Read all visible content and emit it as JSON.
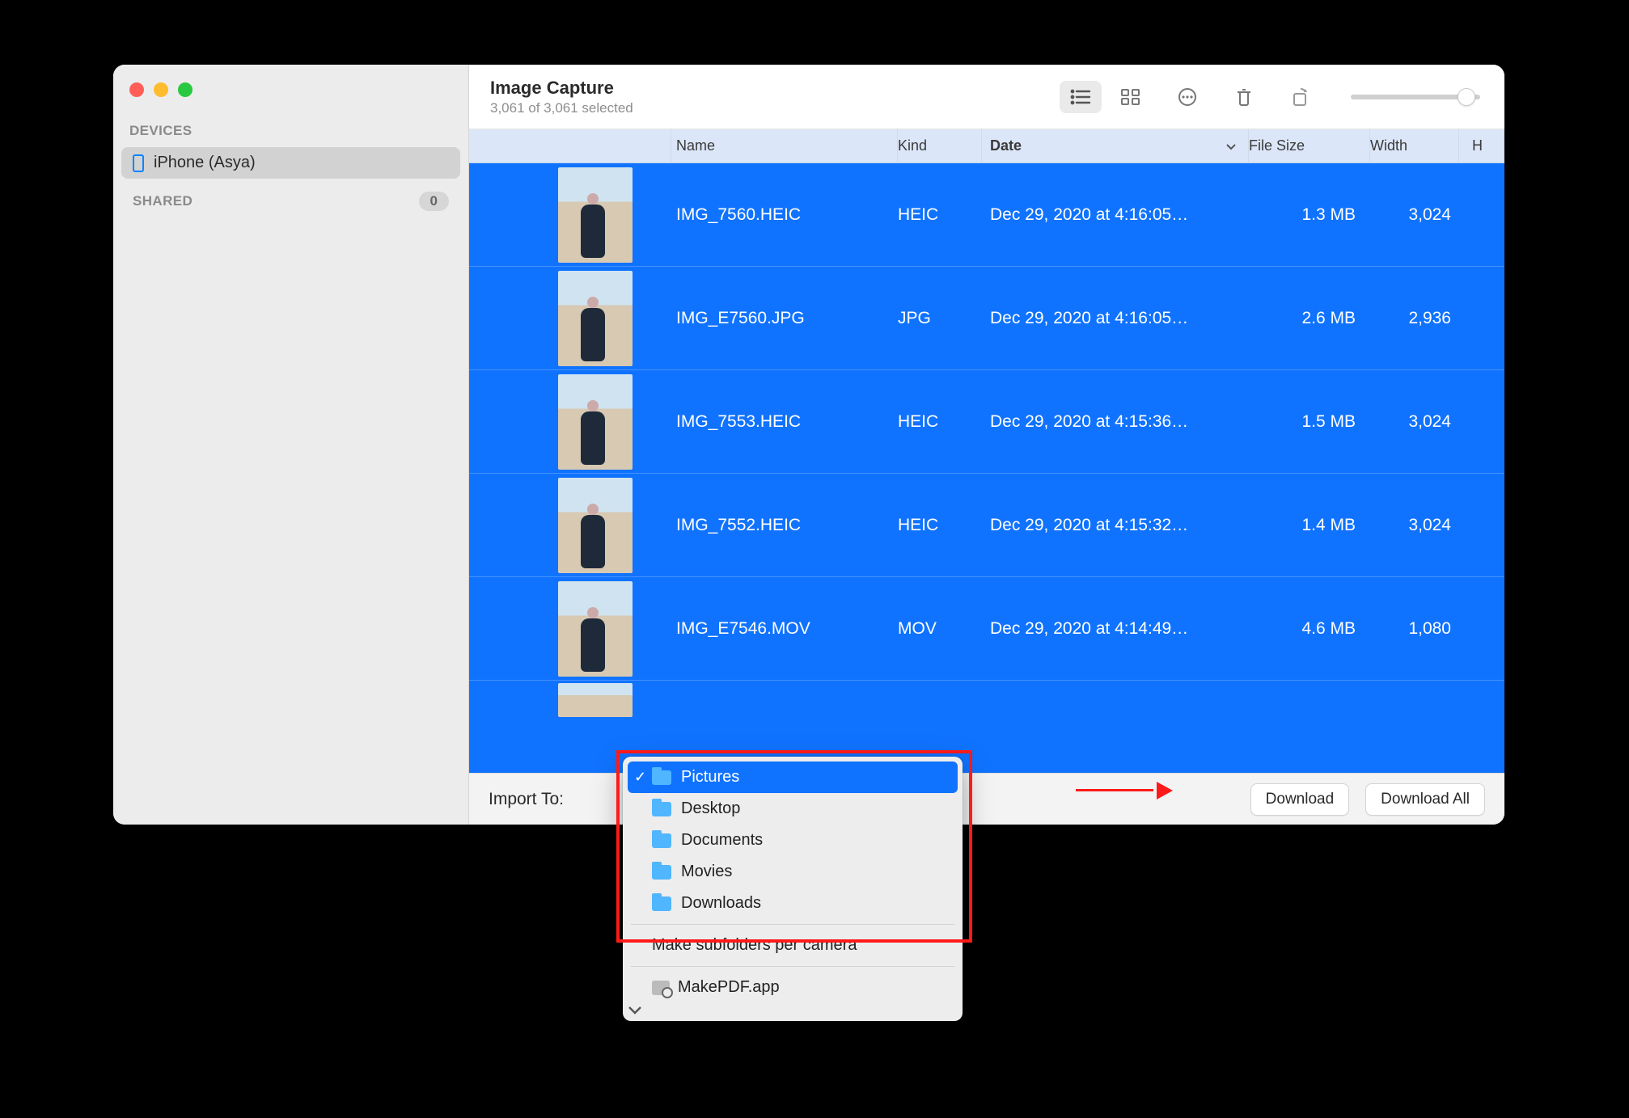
{
  "window": {
    "title": "Image Capture",
    "subtitle": "3,061 of 3,061 selected"
  },
  "sidebar": {
    "sections": {
      "devices_label": "DEVICES",
      "shared_label": "SHARED",
      "shared_count": "0"
    },
    "device_name": "iPhone (Asya)"
  },
  "columns": {
    "name": "Name",
    "kind": "Kind",
    "date": "Date",
    "size": "File Size",
    "width": "Width",
    "h": "H"
  },
  "rows": [
    {
      "name": "IMG_7560.HEIC",
      "kind": "HEIC",
      "date": "Dec 29, 2020 at 4:16:05…",
      "size": "1.3 MB",
      "width": "3,024"
    },
    {
      "name": "IMG_E7560.JPG",
      "kind": "JPG",
      "date": "Dec 29, 2020 at 4:16:05…",
      "size": "2.6 MB",
      "width": "2,936"
    },
    {
      "name": "IMG_7553.HEIC",
      "kind": "HEIC",
      "date": "Dec 29, 2020 at 4:15:36…",
      "size": "1.5 MB",
      "width": "3,024"
    },
    {
      "name": "IMG_7552.HEIC",
      "kind": "HEIC",
      "date": "Dec 29, 2020 at 4:15:32…",
      "size": "1.4 MB",
      "width": "3,024"
    },
    {
      "name": "IMG_E7546.MOV",
      "kind": "MOV",
      "date": "Dec 29, 2020 at 4:14:49…",
      "size": "4.6 MB",
      "width": "1,080"
    }
  ],
  "footer": {
    "import_label": "Import To:",
    "download": "Download",
    "download_all": "Download All"
  },
  "popup": {
    "options": [
      "Pictures",
      "Desktop",
      "Documents",
      "Movies",
      "Downloads"
    ],
    "subfolders": "Make subfolders per camera",
    "app": "MakePDF.app"
  }
}
